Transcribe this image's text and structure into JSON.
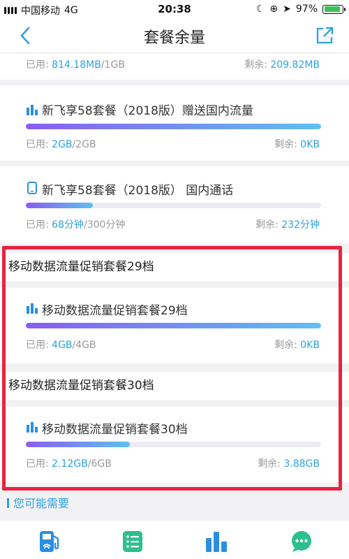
{
  "status": {
    "carrier": "中国移动",
    "network": "4G",
    "time": "20:38",
    "battery": "97%"
  },
  "nav": {
    "title": "套餐余量",
    "back_icon": "chevron-left-icon",
    "share_icon": "share-external-icon"
  },
  "top_partial": {
    "used_label": "已用: ",
    "used_value": "814.18MB",
    "used_total": "/1GB",
    "remain_label": "剩余: ",
    "remain_value": "209.82MB"
  },
  "items": [
    {
      "icon": "bar-chart-icon",
      "title": "新飞享58套餐（2018版）赠送国内流量",
      "used_label": "已用: ",
      "used_value": "2GB",
      "used_total": "/2GB",
      "remain_label": "剩余: ",
      "remain_value": "0KB",
      "progress": 1.0
    },
    {
      "icon": "phone-icon",
      "title": "新飞享58套餐（2018版） 国内通话",
      "used_label": "已用: ",
      "used_value": "68分钟",
      "used_total": "/300分钟",
      "remain_label": "剩余: ",
      "remain_value": "232分钟",
      "progress": 0.2267
    }
  ],
  "sections": [
    {
      "header": "移动数据流量促销套餐29档",
      "item": {
        "icon": "bar-chart-icon",
        "title": "移动数据流量促销套餐29档",
        "used_label": "已用: ",
        "used_value": "4GB",
        "used_total": "/4GB",
        "remain_label": "剩余: ",
        "remain_value": "0KB",
        "progress": 1.0
      }
    },
    {
      "header": "移动数据流量促销套餐30档",
      "item": {
        "icon": "bar-chart-icon",
        "title": "移动数据流量促销套餐30档",
        "used_label": "已用: ",
        "used_value": "2.12GB",
        "used_total": "/6GB",
        "remain_label": "剩余: ",
        "remain_value": "3.88GB",
        "progress": 0.3533
      }
    }
  ],
  "maybe_need": "您可能需要",
  "tabbar": {
    "icons": [
      "gas-station-wifi-icon",
      "list-icon",
      "bar-chart-icon",
      "chat-bubble-icon"
    ]
  },
  "colors": {
    "accent": "#2aa2e0",
    "highlight_border": "#e8243f",
    "progress_start": "#8a5df0",
    "progress_end": "#5fc0f0",
    "tab_green": "#2dbf8c",
    "tab_blue": "#2a8fe0"
  }
}
